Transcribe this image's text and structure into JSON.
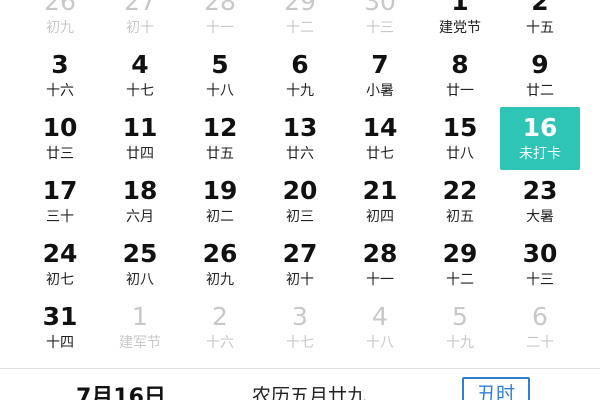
{
  "calendar": {
    "rows": [
      [
        {
          "day": "26",
          "sub": "初九",
          "muted": true
        },
        {
          "day": "27",
          "sub": "初十",
          "muted": true
        },
        {
          "day": "28",
          "sub": "十一",
          "muted": true
        },
        {
          "day": "29",
          "sub": "十二",
          "muted": true
        },
        {
          "day": "30",
          "sub": "十三",
          "muted": true
        },
        {
          "day": "1",
          "sub": "建党节",
          "muted": false
        },
        {
          "day": "2",
          "sub": "十五",
          "muted": false
        }
      ],
      [
        {
          "day": "3",
          "sub": "十六",
          "muted": false
        },
        {
          "day": "4",
          "sub": "十七",
          "muted": false
        },
        {
          "day": "5",
          "sub": "十八",
          "muted": false
        },
        {
          "day": "6",
          "sub": "十九",
          "muted": false
        },
        {
          "day": "7",
          "sub": "小暑",
          "muted": false
        },
        {
          "day": "8",
          "sub": "廿一",
          "muted": false
        },
        {
          "day": "9",
          "sub": "廿二",
          "muted": false
        }
      ],
      [
        {
          "day": "10",
          "sub": "廿三",
          "muted": false
        },
        {
          "day": "11",
          "sub": "廿四",
          "muted": false
        },
        {
          "day": "12",
          "sub": "廿五",
          "muted": false
        },
        {
          "day": "13",
          "sub": "廿六",
          "muted": false
        },
        {
          "day": "14",
          "sub": "廿七",
          "muted": false
        },
        {
          "day": "15",
          "sub": "廿八",
          "muted": false
        },
        {
          "day": "16",
          "sub": "未打卡",
          "muted": false,
          "selected": true
        }
      ],
      [
        {
          "day": "17",
          "sub": "三十",
          "muted": false
        },
        {
          "day": "18",
          "sub": "六月",
          "muted": false
        },
        {
          "day": "19",
          "sub": "初二",
          "muted": false
        },
        {
          "day": "20",
          "sub": "初三",
          "muted": false
        },
        {
          "day": "21",
          "sub": "初四",
          "muted": false
        },
        {
          "day": "22",
          "sub": "初五",
          "muted": false
        },
        {
          "day": "23",
          "sub": "大暑",
          "muted": false
        }
      ],
      [
        {
          "day": "24",
          "sub": "初七",
          "muted": false
        },
        {
          "day": "25",
          "sub": "初八",
          "muted": false
        },
        {
          "day": "26",
          "sub": "初九",
          "muted": false
        },
        {
          "day": "27",
          "sub": "初十",
          "muted": false
        },
        {
          "day": "28",
          "sub": "十一",
          "muted": false
        },
        {
          "day": "29",
          "sub": "十二",
          "muted": false
        },
        {
          "day": "30",
          "sub": "十三",
          "muted": false
        }
      ],
      [
        {
          "day": "31",
          "sub": "十四",
          "muted": false
        },
        {
          "day": "1",
          "sub": "建军节",
          "muted": true
        },
        {
          "day": "2",
          "sub": "十六",
          "muted": true
        },
        {
          "day": "3",
          "sub": "十七",
          "muted": true
        },
        {
          "day": "4",
          "sub": "十八",
          "muted": true
        },
        {
          "day": "5",
          "sub": "十九",
          "muted": true
        },
        {
          "day": "6",
          "sub": "二十",
          "muted": true
        }
      ]
    ]
  },
  "footer": {
    "date": "7月16日",
    "lunar": "农历五月廿九",
    "badge": "丑时"
  },
  "colors": {
    "accent": "#2ec4b6",
    "badge": "#2e7fd9",
    "muted_text": "#c8c8c8"
  }
}
